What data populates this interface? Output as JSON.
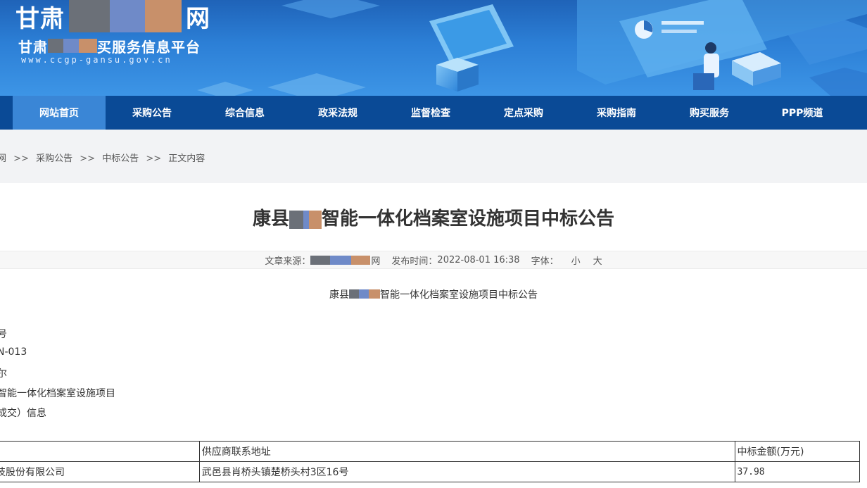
{
  "header": {
    "site_title_prefix": "甘肃",
    "site_title_suffix": "网",
    "subtitle_prefix": "甘肃",
    "subtitle_suffix": "买服务信息平台",
    "url": "www.ccgp-gansu.gov.cn",
    "redaction_colors": [
      "#6b7078",
      "#6f8ac8",
      "#c8906a"
    ]
  },
  "nav": {
    "items": [
      {
        "label": "网站首页",
        "active": true
      },
      {
        "label": "采购公告"
      },
      {
        "label": "综合信息"
      },
      {
        "label": "政采法规"
      },
      {
        "label": "监督检查"
      },
      {
        "label": "定点采购"
      },
      {
        "label": "采购指南"
      },
      {
        "label": "购买服务"
      },
      {
        "label": "PPP频道"
      }
    ]
  },
  "breadcrumb": {
    "items": [
      "网",
      "采购公告",
      "中标公告",
      "正文内容"
    ],
    "separator": ">>"
  },
  "article": {
    "title_prefix": "康县",
    "title_suffix": "智能一体化档案室设施项目中标公告",
    "meta": {
      "source_label": "文章来源：",
      "source_suffix": "网",
      "publish_label": "发布时间：",
      "publish_time": "2022-08-01 16:38",
      "font_label": "字体：",
      "font_small": "小",
      "font_large": "大"
    },
    "subtitle_prefix": "康县",
    "subtitle_suffix": "智能一体化档案室设施项目中标公告",
    "lines": [
      "号",
      "N-013",
      "尔",
      "智能一体化档案室设施项目",
      "成交）信息"
    ]
  },
  "bid_table": {
    "headers": [
      "",
      "供应商联系地址",
      "中标金额(万元)"
    ],
    "rows": [
      [
        "技股份有限公司",
        "武邑县肖桥头镇楚桥头村3区16号",
        "37.98"
      ]
    ]
  }
}
